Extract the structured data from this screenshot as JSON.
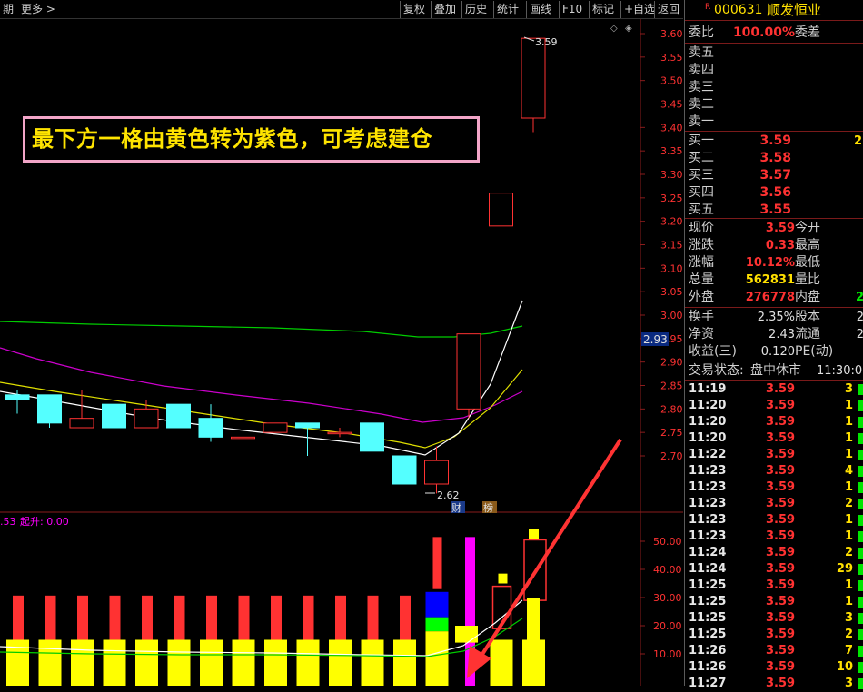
{
  "toolbar": {
    "left_items": [
      "期",
      "更多 >"
    ],
    "buttons": [
      "复权",
      "叠加",
      "历史",
      "统计",
      "画线",
      "F10",
      "标记",
      "+自选",
      "返回"
    ]
  },
  "annotation_banner": "最下方一格由黄色转为紫色，可考虑建仓",
  "price_axis": {
    "ticks": [
      "3.60",
      "3.55",
      "3.50",
      "3.45",
      "3.40",
      "3.35",
      "3.30",
      "3.25",
      "3.20",
      "3.15",
      "3.10",
      "3.05",
      "3.00",
      "2.95",
      "2.90",
      "2.85",
      "2.80",
      "2.75",
      "2.70"
    ],
    "current_marker": "2.93",
    "high_label": "3.59",
    "low_label": "2.62"
  },
  "badges": {
    "cai": "财",
    "bang": "榜"
  },
  "indicator": {
    "header_left": ".53",
    "header_label": "起升: 0.00",
    "axis_ticks": [
      "50.00",
      "40.00",
      "30.00",
      "20.00",
      "10.00"
    ]
  },
  "colors": {
    "up": "#ff3232",
    "down": "#54ffff",
    "yellow": "#ffff00",
    "magenta": "#ff00ff",
    "blue": "#0000ff",
    "green": "#00ff00",
    "ma_green": "#00cc00",
    "ma_purple": "#cc00cc",
    "ma_yellow": "#e0e000",
    "arrow": "#ff3333"
  },
  "stock": {
    "badge": "R",
    "code": "000631",
    "name": "顺发恒业"
  },
  "quote": {
    "weibi_label": "委比",
    "weibi_value": "100.00%",
    "weicha_label": "委差",
    "weicha_value": "",
    "sells": [
      {
        "label": "卖五",
        "price": "",
        "vol": ""
      },
      {
        "label": "卖四",
        "price": "",
        "vol": ""
      },
      {
        "label": "卖三",
        "price": "",
        "vol": ""
      },
      {
        "label": "卖二",
        "price": "",
        "vol": ""
      },
      {
        "label": "卖一",
        "price": "",
        "vol": ""
      }
    ],
    "buys": [
      {
        "label": "买一",
        "price": "3.59",
        "vol": "2"
      },
      {
        "label": "买二",
        "price": "3.58",
        "vol": ""
      },
      {
        "label": "买三",
        "price": "3.57",
        "vol": ""
      },
      {
        "label": "买四",
        "price": "3.56",
        "vol": ""
      },
      {
        "label": "买五",
        "price": "3.55",
        "vol": ""
      }
    ],
    "stats": [
      {
        "l1": "现价",
        "v1": "3.59",
        "c1": "red",
        "l2": "今开",
        "v2": ""
      },
      {
        "l1": "涨跌",
        "v1": "0.33",
        "c1": "red",
        "l2": "最高",
        "v2": ""
      },
      {
        "l1": "涨幅",
        "v1": "10.12%",
        "c1": "red",
        "l2": "最低",
        "v2": ""
      },
      {
        "l1": "总量",
        "v1": "562831",
        "c1": "ylw",
        "l2": "量比",
        "v2": ""
      },
      {
        "l1": "外盘",
        "v1": "276778",
        "c1": "red",
        "l2": "内盘",
        "v2": "2"
      }
    ],
    "stats2": [
      {
        "l1": "换手",
        "v1": "2.35%",
        "l2": "股本",
        "v2": "2"
      },
      {
        "l1": "净资",
        "v1": "2.43",
        "l2": "流通",
        "v2": "2"
      },
      {
        "l1": "收益(三)",
        "v1": "0.120",
        "l2": "PE(动)",
        "v2": ""
      }
    ],
    "status_label": "交易状态:",
    "status_value": "盘中休市",
    "status_time": "11:30:00"
  },
  "ticks": [
    {
      "time": "11:19",
      "price": "3.59",
      "vol": "3"
    },
    {
      "time": "11:20",
      "price": "3.59",
      "vol": "1"
    },
    {
      "time": "11:20",
      "price": "3.59",
      "vol": "1"
    },
    {
      "time": "11:20",
      "price": "3.59",
      "vol": "1"
    },
    {
      "time": "11:22",
      "price": "3.59",
      "vol": "1"
    },
    {
      "time": "11:23",
      "price": "3.59",
      "vol": "4"
    },
    {
      "time": "11:23",
      "price": "3.59",
      "vol": "1"
    },
    {
      "time": "11:23",
      "price": "3.59",
      "vol": "2"
    },
    {
      "time": "11:23",
      "price": "3.59",
      "vol": "1"
    },
    {
      "time": "11:23",
      "price": "3.59",
      "vol": "1"
    },
    {
      "time": "11:24",
      "price": "3.59",
      "vol": "2"
    },
    {
      "time": "11:24",
      "price": "3.59",
      "vol": "29"
    },
    {
      "time": "11:25",
      "price": "3.59",
      "vol": "1"
    },
    {
      "time": "11:25",
      "price": "3.59",
      "vol": "1"
    },
    {
      "time": "11:25",
      "price": "3.59",
      "vol": "3"
    },
    {
      "time": "11:25",
      "price": "3.59",
      "vol": "2"
    },
    {
      "time": "11:26",
      "price": "3.59",
      "vol": "7"
    },
    {
      "time": "11:26",
      "price": "3.59",
      "vol": "10"
    },
    {
      "time": "11:27",
      "price": "3.59",
      "vol": "3"
    }
  ],
  "candles": [
    {
      "o": 2.83,
      "h": 2.84,
      "l": 2.79,
      "c": 2.82
    },
    {
      "o": 2.83,
      "h": 2.83,
      "l": 2.76,
      "c": 2.77
    },
    {
      "o": 2.76,
      "h": 2.84,
      "l": 2.76,
      "c": 2.78
    },
    {
      "o": 2.81,
      "h": 2.82,
      "l": 2.75,
      "c": 2.76
    },
    {
      "o": 2.76,
      "h": 2.82,
      "l": 2.76,
      "c": 2.8
    },
    {
      "o": 2.81,
      "h": 2.81,
      "l": 2.76,
      "c": 2.76
    },
    {
      "o": 2.78,
      "h": 2.81,
      "l": 2.73,
      "c": 2.74
    },
    {
      "o": 2.74,
      "h": 2.75,
      "l": 2.73,
      "c": 2.74
    },
    {
      "o": 2.75,
      "h": 2.77,
      "l": 2.75,
      "c": 2.77
    },
    {
      "o": 2.77,
      "h": 2.77,
      "l": 2.7,
      "c": 2.76
    },
    {
      "o": 2.75,
      "h": 2.76,
      "l": 2.74,
      "c": 2.75
    },
    {
      "o": 2.77,
      "h": 2.77,
      "l": 2.71,
      "c": 2.71
    },
    {
      "o": 2.7,
      "h": 2.7,
      "l": 2.64,
      "c": 2.64
    },
    {
      "o": 2.64,
      "h": 2.72,
      "l": 2.62,
      "c": 2.69
    },
    {
      "o": 2.8,
      "h": 2.96,
      "l": 2.78,
      "c": 2.96
    },
    {
      "o": 3.19,
      "h": 3.26,
      "l": 3.12,
      "c": 3.26
    },
    {
      "o": 3.42,
      "h": 3.59,
      "l": 3.39,
      "c": 3.59
    }
  ],
  "bars": [
    {
      "red": 18,
      "yellow": 14
    },
    {
      "red": 18,
      "yellow": 14
    },
    {
      "red": 18,
      "yellow": 14
    },
    {
      "red": 18,
      "yellow": 14
    },
    {
      "red": 18,
      "yellow": 14
    },
    {
      "red": 18,
      "yellow": 14
    },
    {
      "red": 18,
      "yellow": 14
    },
    {
      "red": 18,
      "yellow": 14
    },
    {
      "red": 18,
      "yellow": 14
    },
    {
      "red": 18,
      "yellow": 14
    },
    {
      "red": 18,
      "yellow": 14
    },
    {
      "red": 18,
      "yellow": 14
    },
    {
      "red": 18,
      "yellow": 14
    },
    {
      "special": "c13"
    },
    {
      "special": "c14"
    },
    {
      "special": "c15"
    },
    {
      "special": "c16"
    }
  ]
}
